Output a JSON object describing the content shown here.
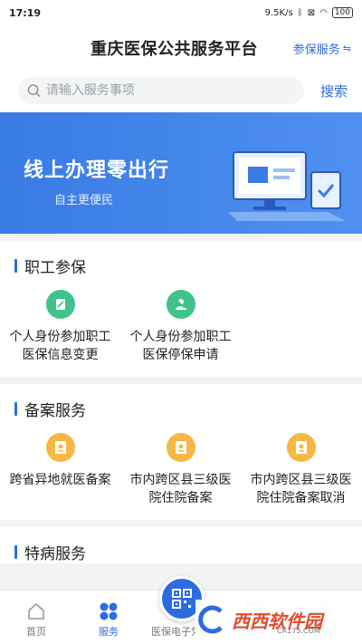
{
  "status_bar": {
    "time": "17:19",
    "net_speed": "9.5K/s",
    "battery": "100"
  },
  "header": {
    "title": "重庆医保公共服务平台",
    "switch_label": "参保服务",
    "switch_icon": "swap-icon"
  },
  "search": {
    "placeholder": "请输入服务事项",
    "button_label": "搜索"
  },
  "banner": {
    "title": "线上办理零出行",
    "subtitle": "自主更便民"
  },
  "sections": [
    {
      "title": "职工参保",
      "items": [
        {
          "label": "个人身份参加职工医保信息变更",
          "icon": "edit-document-icon",
          "color": "#3fc38a"
        },
        {
          "label": "个人身份参加职工医保停保申请",
          "icon": "stop-person-icon",
          "color": "#3fc38a"
        }
      ]
    },
    {
      "title": "备案服务",
      "items": [
        {
          "label": "跨省异地就医备案",
          "icon": "document-icon",
          "color": "#f6b844"
        },
        {
          "label": "市内跨区县三级医院住院备案",
          "icon": "document-icon",
          "color": "#f6b844"
        },
        {
          "label": "市内跨区县三级医院住院备案取消",
          "icon": "document-icon",
          "color": "#f6b844"
        }
      ]
    },
    {
      "title": "特病服务"
    }
  ],
  "tabs": [
    {
      "label": "首页",
      "icon": "home-icon"
    },
    {
      "label": "服务",
      "icon": "services-icon",
      "active": true
    },
    {
      "label": "医保电子凭证",
      "icon": "qr-code-icon"
    },
    {
      "label": "资讯",
      "icon": "news-icon"
    },
    {
      "label": "我的",
      "icon": "user-icon"
    }
  ],
  "watermark": {
    "text": "西西软件园",
    "url": "CR173.COM"
  },
  "colors": {
    "accent": "#2d6be0",
    "green": "#3fc38a",
    "orange": "#f6b844"
  }
}
